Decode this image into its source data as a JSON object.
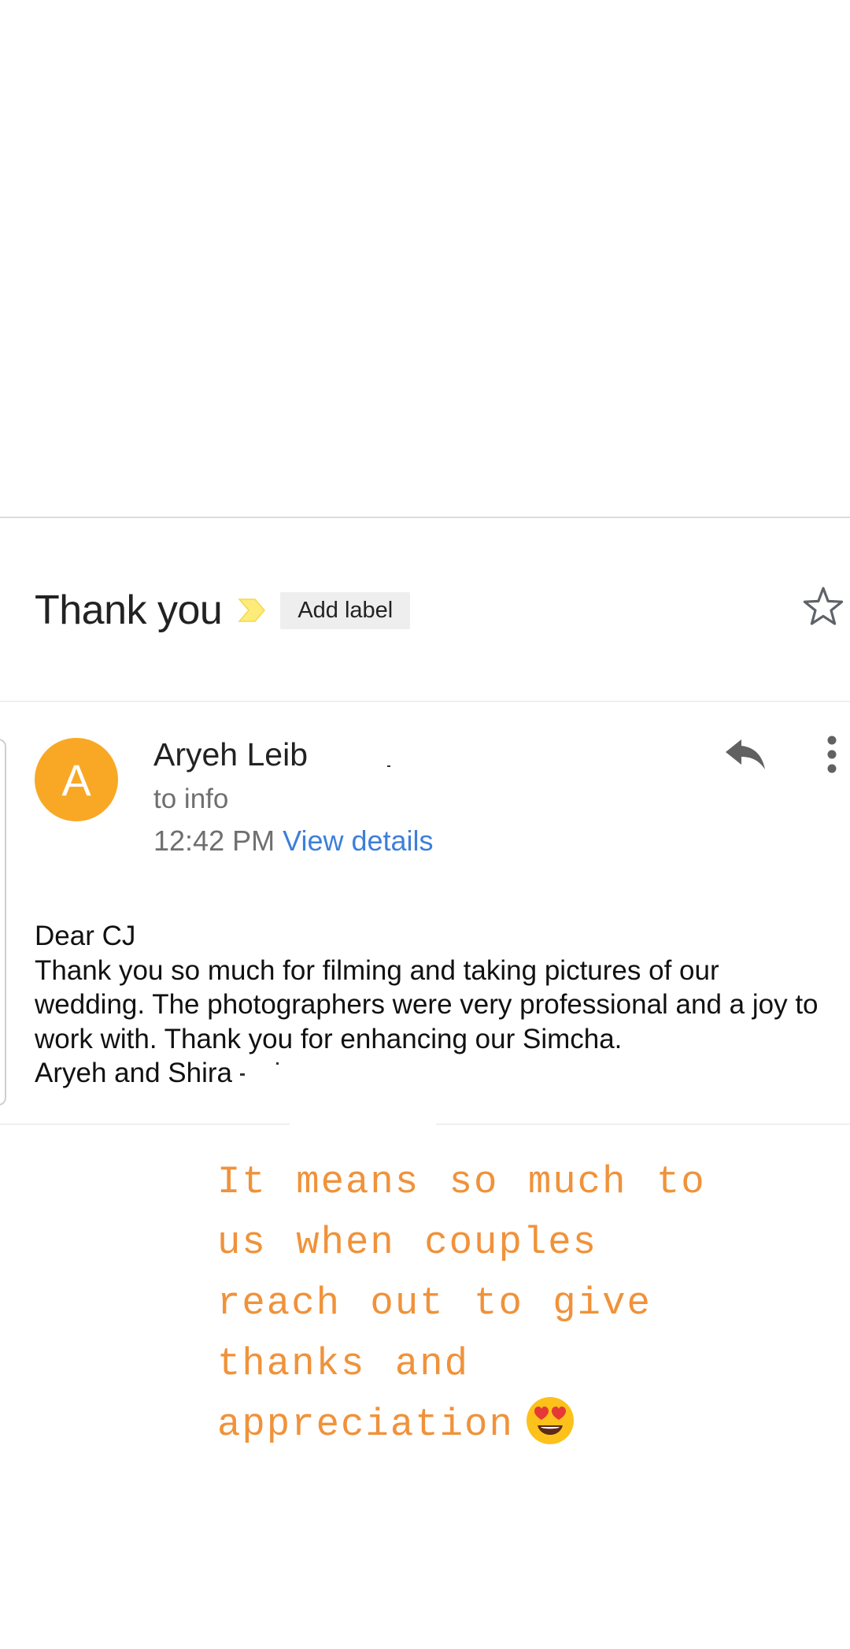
{
  "subject": {
    "title": "Thank you",
    "add_label": "Add label",
    "importance_icon": "importance-marker-icon",
    "star_icon": "star-outline-icon"
  },
  "sender": {
    "avatar_letter": "A",
    "avatar_color": "#f9a825",
    "name": "Aryeh Leib",
    "recipient": "to info",
    "time": "12:42 PM",
    "view_details": "View details",
    "reply_icon": "reply-icon",
    "more_icon": "more-vert-icon"
  },
  "body": {
    "greeting": "Dear CJ",
    "message": "Thank you so much for filming and taking pictures of our wedding. The photographers were very professional and a joy to work with. Thank you for enhancing our Simcha.",
    "signature": "Aryeh and Shira"
  },
  "caption": {
    "line1": "It means so much to",
    "line2": "us when couples",
    "line3": "reach out to give",
    "line4": "thanks and",
    "line5": "appreciation",
    "emoji": "heart-eyes-emoji",
    "color": "#f0923a"
  }
}
